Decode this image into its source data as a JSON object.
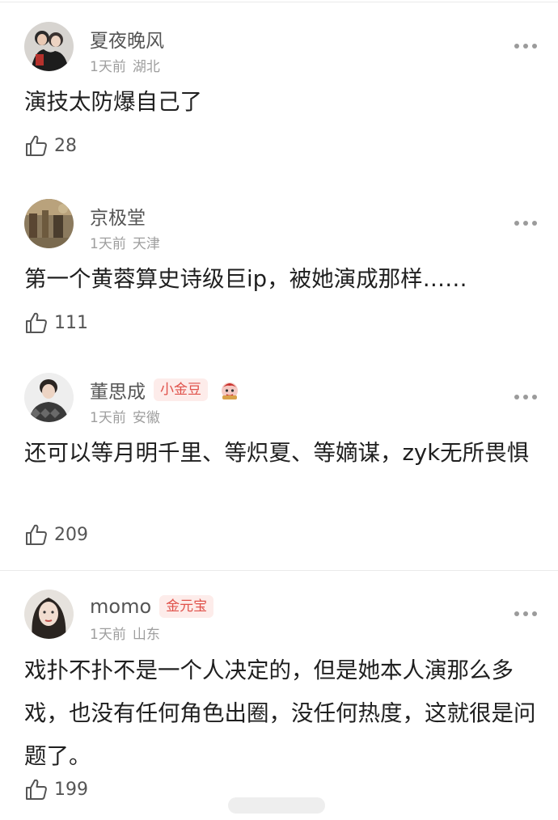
{
  "comments": [
    {
      "username": "夏夜晚风",
      "time": "1天前",
      "location": "湖北",
      "text": "演技太防爆自己了",
      "likes": "28",
      "avatar_icon": "couple-photo-avatar"
    },
    {
      "username": "京极堂",
      "time": "1天前",
      "location": "天津",
      "text": "第一个黄蓉算史诗级巨ip，被她演成那样……",
      "likes": "111",
      "avatar_icon": "painting-avatar"
    },
    {
      "username": "董思成",
      "badge": "小金豆",
      "badge_icon": "cartoon-character-icon",
      "time": "1天前",
      "location": "安徽",
      "text": "还可以等月明千里、等炽夏、等嫡谋，zyk无所畏惧",
      "likes": "209",
      "avatar_icon": "person-portrait-avatar"
    },
    {
      "username": "momo",
      "badge": "金元宝",
      "time": "1天前",
      "location": "山东",
      "text": "戏扑不扑不是一个人决定的，但是她本人演那么多戏，也没有任何角色出圈，没任何热度，这就很是问题了。",
      "likes": "199",
      "avatar_icon": "woman-portrait-avatar"
    }
  ],
  "colors": {
    "badge_text": "#e0524b",
    "badge_bg": "#fdecea",
    "meta_text": "#9e9e9e"
  }
}
